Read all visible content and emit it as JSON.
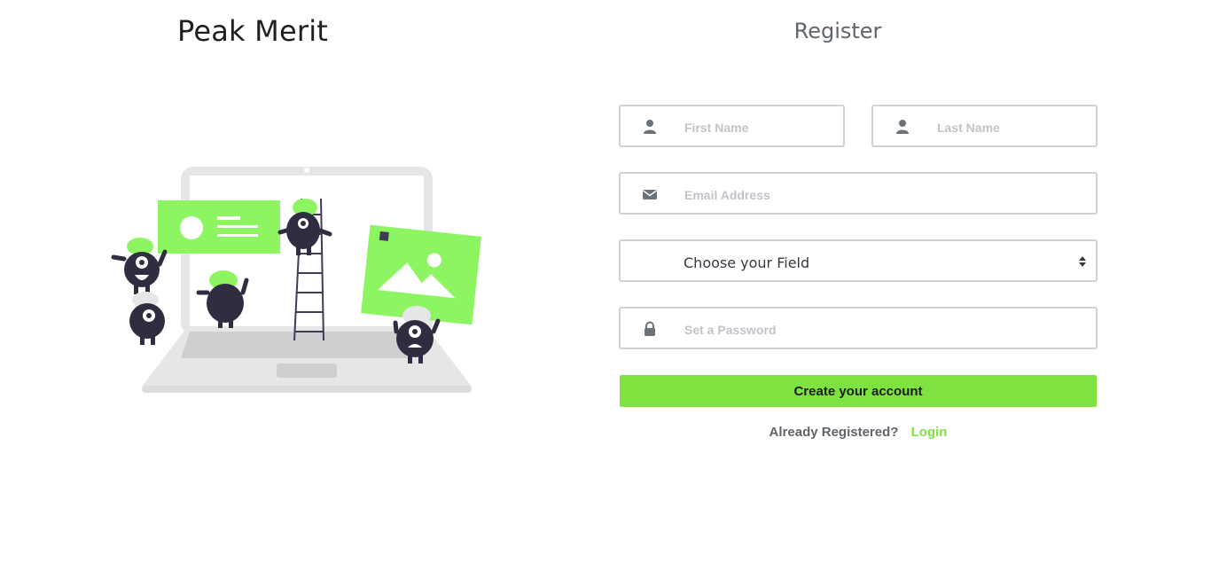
{
  "brand": {
    "title": "Peak Merit"
  },
  "form": {
    "title": "Register",
    "first_name_placeholder": "First Name",
    "last_name_placeholder": "Last Name",
    "email_placeholder": "Email Address",
    "field_select_value": "Choose your Field",
    "password_placeholder": "Set a Password",
    "submit_label": "Create your account",
    "already_registered_text": "Already Registered?",
    "login_label": "Login"
  },
  "colors": {
    "accent": "#7ee241",
    "border": "#ced3d8",
    "muted_text": "#5f656b",
    "illustration_dark": "#2f2e41",
    "laptop_gray": "#e6e6e6"
  },
  "icons": {
    "first_name": "user-icon",
    "last_name": "user-icon",
    "email": "envelope-icon",
    "password": "lock-icon",
    "select": "sort-caret-icon"
  }
}
